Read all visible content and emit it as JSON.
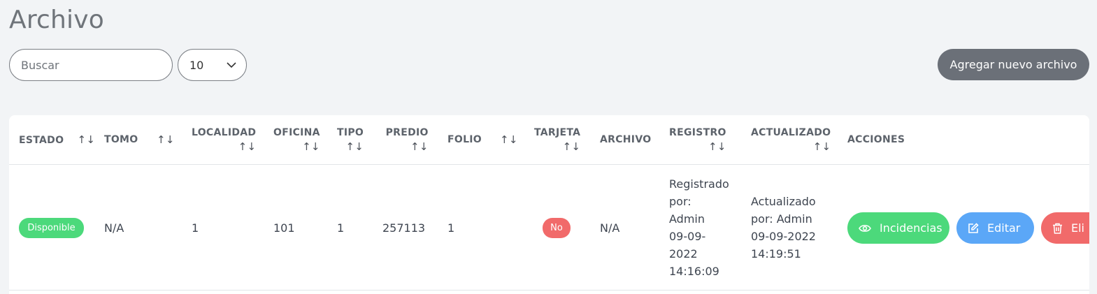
{
  "page": {
    "title": "Archivo"
  },
  "toolbar": {
    "search_placeholder": "Buscar",
    "per_page_value": "10",
    "add_button_label": "Agregar nuevo archivo"
  },
  "table": {
    "headers": {
      "estado": "ESTADO",
      "tomo": "TOMO",
      "localidad": "LOCALIDAD",
      "oficina": "OFICINA",
      "tipo": "TIPO",
      "predio": "PREDIO",
      "folio": "FOLIO",
      "tarjeta": "TARJETA",
      "archivo": "ARCHIVO",
      "registro": "REGISTRO",
      "actualizado": "ACTUALIZADO",
      "acciones": "ACCIONES"
    },
    "sort_glyph": "↑↓",
    "row": {
      "estado": "Disponible",
      "tomo": "N/A",
      "localidad": "1",
      "oficina": "101",
      "tipo": "1",
      "predio": "257113",
      "folio": "1",
      "tarjeta": "No",
      "archivo": "N/A",
      "registro_lines": [
        "Registrado",
        "por:",
        "Admin",
        "09-09-",
        "2022",
        "14:16:09"
      ],
      "actualizado_lines": [
        "Actualizado",
        "por: Admin",
        "09-09-2022",
        "14:19:51"
      ],
      "actions": {
        "incidencias": "Incidencias",
        "editar": "Editar",
        "eliminar": "Eli"
      }
    }
  },
  "colors": {
    "green": "#4cd97b",
    "blue": "#5ba7f7",
    "red": "#f16a6a",
    "gray_button": "#6b7078"
  },
  "icons": {
    "per_page": "chevron-down-icon",
    "sort": "sort-arrows-icon",
    "incidencias": "eye-icon",
    "editar": "edit-icon",
    "eliminar": "trash-icon"
  }
}
